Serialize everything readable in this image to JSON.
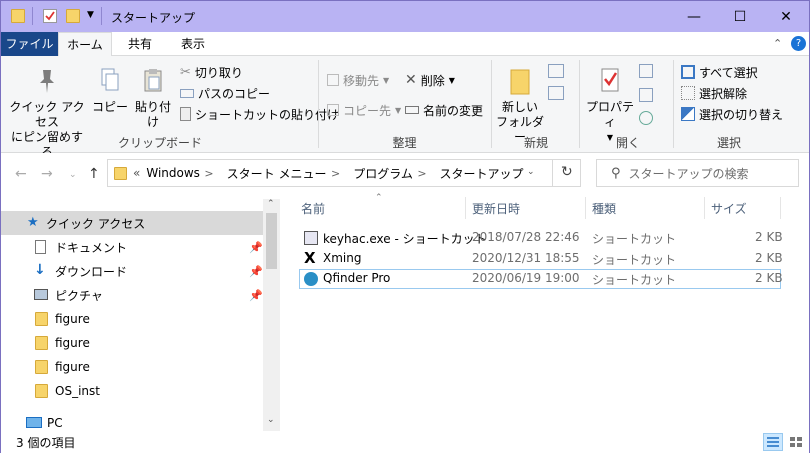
{
  "window": {
    "title": "スタートアップ",
    "minimize": "—",
    "maximize": "☐",
    "close": "✕"
  },
  "ribbon_tabs": [
    "ファイル",
    "ホーム",
    "共有",
    "表示"
  ],
  "ribbon": {
    "clipboard": {
      "pin_quick_access_line1": "クイック アクセス",
      "pin_quick_access_line2": "にピン留めする",
      "copy": "コピー",
      "paste": "貼り付け",
      "cut": "切り取り",
      "copy_path": "パスのコピー",
      "paste_shortcut": "ショートカットの貼り付け",
      "label": "クリップボード"
    },
    "organize": {
      "move_to": "移動先",
      "copy_to": "コピー先",
      "delete": "削除",
      "rename": "名前の変更",
      "label": "整理"
    },
    "new": {
      "new_folder_line1": "新しい",
      "new_folder_line2": "フォルダー",
      "label": "新規"
    },
    "open": {
      "properties": "プロパティ",
      "label": "開く"
    },
    "select": {
      "select_all": "すべて選択",
      "select_none": "選択解除",
      "invert": "選択の切り替え",
      "label": "選択"
    }
  },
  "address": {
    "overflow": "«",
    "crumbs": [
      "Windows",
      "スタート メニュー",
      "プログラム",
      "スタートアップ"
    ],
    "search_placeholder": "スタートアップの検索"
  },
  "sidebar": {
    "items": [
      {
        "label": "クイック アクセス",
        "icon": "star-icon"
      },
      {
        "label": "ドキュメント",
        "icon": "document-icon"
      },
      {
        "label": "ダウンロード",
        "icon": "download-arrow-icon"
      },
      {
        "label": "ピクチャ",
        "icon": "pictures-icon"
      },
      {
        "label": "figure",
        "icon": "folder-icon"
      },
      {
        "label": "figure",
        "icon": "folder-icon"
      },
      {
        "label": "figure",
        "icon": "folder-icon"
      },
      {
        "label": "OS_inst",
        "icon": "folder-icon"
      },
      {
        "label": "PC",
        "icon": "pc-icon"
      }
    ]
  },
  "columns": [
    "名前",
    "更新日時",
    "種類",
    "サイズ"
  ],
  "files": [
    {
      "name": "keyhac.exe - ショートカット",
      "date": "2018/07/28 22:46",
      "type": "ショートカット",
      "size": "2 KB",
      "icon": "keyhac-shortcut-icon"
    },
    {
      "name": "Xming",
      "date": "2020/12/31 18:55",
      "type": "ショートカット",
      "size": "2 KB",
      "icon": "xming-icon"
    },
    {
      "name": "Qfinder Pro",
      "date": "2020/06/19 19:00",
      "type": "ショートカット",
      "size": "2 KB",
      "icon": "qfinder-icon"
    }
  ],
  "status": {
    "item_count": "3 個の項目"
  },
  "colors": {
    "titlebar": "#b9b3f3",
    "file_tab": "#19478a",
    "selected_sidebar": "#d9d9d9",
    "folder": "#f7d46a"
  }
}
